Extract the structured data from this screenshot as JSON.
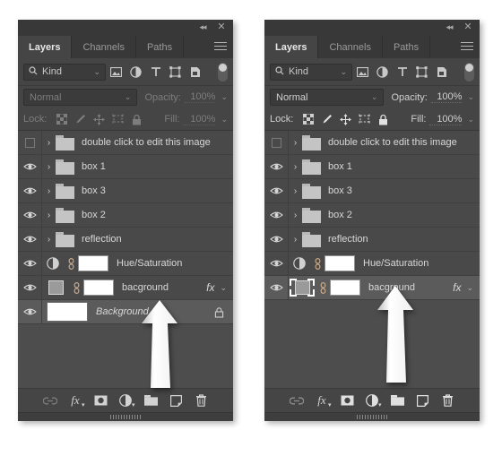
{
  "app": {
    "panel_title": "Layers",
    "titlebar": {
      "collapse_label": "◂◂",
      "close_label": "✕"
    },
    "tabs": [
      {
        "label": "Layers",
        "active": true
      },
      {
        "label": "Channels",
        "active": false
      },
      {
        "label": "Paths",
        "active": false
      }
    ],
    "menu_icon": "hamburger-menu-icon"
  },
  "filter_bar": {
    "kind_label": "Kind",
    "search_icon": "search-icon",
    "caret": "⌄",
    "type_filters": [
      {
        "name": "filter-pixel-layers-icon",
        "title": "Pixel layers"
      },
      {
        "name": "filter-adjustment-layers-icon",
        "title": "Adjustment layers"
      },
      {
        "name": "filter-type-layers-icon",
        "title": "Type layers"
      },
      {
        "name": "filter-shape-layers-icon",
        "title": "Shape layers"
      },
      {
        "name": "filter-smart-object-icon",
        "title": "Smart objects"
      }
    ],
    "toggle_name": "filter-enable-toggle"
  },
  "blend_bar": {
    "blend_mode": "Normal",
    "opacity_label": "Opacity:",
    "opacity_value": "100%",
    "caret": "⌄"
  },
  "lock_bar": {
    "lock_label": "Lock:",
    "lock_icons": [
      {
        "name": "lock-transparent-pixels-icon"
      },
      {
        "name": "lock-image-pixels-icon"
      },
      {
        "name": "lock-position-icon"
      },
      {
        "name": "lock-artboard-nesting-icon"
      },
      {
        "name": "lock-all-icon"
      }
    ],
    "fill_label": "Fill:",
    "fill_value": "100%"
  },
  "panels": [
    {
      "id": "left",
      "controls_enabled": false,
      "layers": [
        {
          "name": "double click to edit this image",
          "type": "group",
          "visible": false,
          "selected": false
        },
        {
          "name": "box 1",
          "type": "group",
          "visible": true,
          "selected": false
        },
        {
          "name": "box 3",
          "type": "group",
          "visible": true,
          "selected": false
        },
        {
          "name": "box 2",
          "type": "group",
          "visible": true,
          "selected": false
        },
        {
          "name": "reflection",
          "type": "group",
          "visible": true,
          "selected": false
        },
        {
          "name": "Hue/Saturation",
          "type": "adjustment",
          "visible": true,
          "selected": false,
          "linked": true,
          "has_mask": true
        },
        {
          "name": "bacground",
          "type": "pixel-with-mask",
          "visible": true,
          "selected": false,
          "linked": true,
          "has_mask": true,
          "effects_label": "fx",
          "effects_caret": "⌄"
        },
        {
          "name": "Background",
          "type": "background",
          "visible": true,
          "selected": true,
          "italic": true,
          "locked": true
        }
      ]
    },
    {
      "id": "right",
      "controls_enabled": true,
      "layers": [
        {
          "name": "double click to edit this image",
          "type": "group",
          "visible": false,
          "selected": false
        },
        {
          "name": "box 1",
          "type": "group",
          "visible": true,
          "selected": false
        },
        {
          "name": "box 3",
          "type": "group",
          "visible": true,
          "selected": false
        },
        {
          "name": "box 2",
          "type": "group",
          "visible": true,
          "selected": false
        },
        {
          "name": "reflection",
          "type": "group",
          "visible": true,
          "selected": false
        },
        {
          "name": "Hue/Saturation",
          "type": "adjustment",
          "visible": true,
          "selected": false,
          "linked": true,
          "has_mask": true
        },
        {
          "name": "bacground",
          "type": "pixel-with-mask",
          "visible": true,
          "selected": true,
          "linked": true,
          "has_mask": true,
          "effects_label": "fx",
          "effects_caret": "⌄"
        }
      ]
    }
  ],
  "bottom_toolbar": {
    "buttons": [
      {
        "name": "link-layers-button",
        "label": "link"
      },
      {
        "name": "add-layer-style-button",
        "label": "fx",
        "has_caret": true
      },
      {
        "name": "add-layer-mask-button",
        "label": "mask"
      },
      {
        "name": "new-adjustment-layer-button",
        "label": "adjustment",
        "has_caret": true
      },
      {
        "name": "new-group-button",
        "label": "group"
      },
      {
        "name": "new-layer-button",
        "label": "new"
      },
      {
        "name": "delete-layer-button",
        "label": "trash"
      }
    ]
  },
  "annotations": [
    {
      "name": "pointer-arrow-left",
      "points_to": "Background"
    },
    {
      "name": "pointer-arrow-right",
      "points_to": "bacground"
    }
  ],
  "colors": {
    "panel_bg": "#454545",
    "list_bg": "#4d4d4d",
    "row_bg": "#494949",
    "row_selected_bg": "#5b5b5b",
    "tabbar_bg": "#383838",
    "text": "#d8d8d8",
    "text_dim": "#7d7d7d",
    "arrow": "#ffffff"
  }
}
